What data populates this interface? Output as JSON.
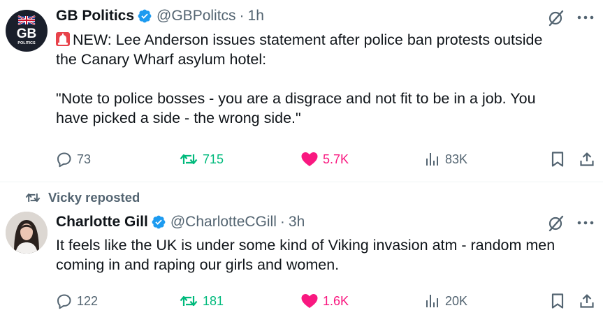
{
  "tweets": [
    {
      "display_name": "GB Politics",
      "handle": "@GBPolitcs",
      "separator": "·",
      "time": "1h",
      "avatar": {
        "text": "GB",
        "subtext": "POLITICS",
        "flag_icon": "union-jack-icon"
      },
      "text_lines": [
        "NEW: Lee Anderson issues statement after police ban protests outside",
        "the Canary Wharf asylum hotel:",
        "",
        "\"Note to police bosses - you are a disgrace and not fit to be in a job. You",
        "have picked a side - the wrong side.\""
      ],
      "lead_emoji": "police-siren-icon",
      "counts": {
        "replies": "73",
        "reposts": "715",
        "likes": "5.7K",
        "views": "83K"
      },
      "liked": true
    },
    {
      "social_context": "Vicky reposted",
      "display_name": "Charlotte Gill",
      "handle": "@CharlotteCGill",
      "separator": "·",
      "time": "3h",
      "text_lines": [
        "It feels like the UK is under some kind of Viking invasion atm - random men",
        "coming in and raping our girls and women."
      ],
      "counts": {
        "replies": "122",
        "reposts": "181",
        "likes": "1.6K",
        "views": "20K"
      },
      "liked": true
    }
  ],
  "colors": {
    "text": "#0f1419",
    "secondary": "#536471",
    "verified": "#1d9bf0",
    "repost": "#00ba7c",
    "like": "#f91880"
  }
}
